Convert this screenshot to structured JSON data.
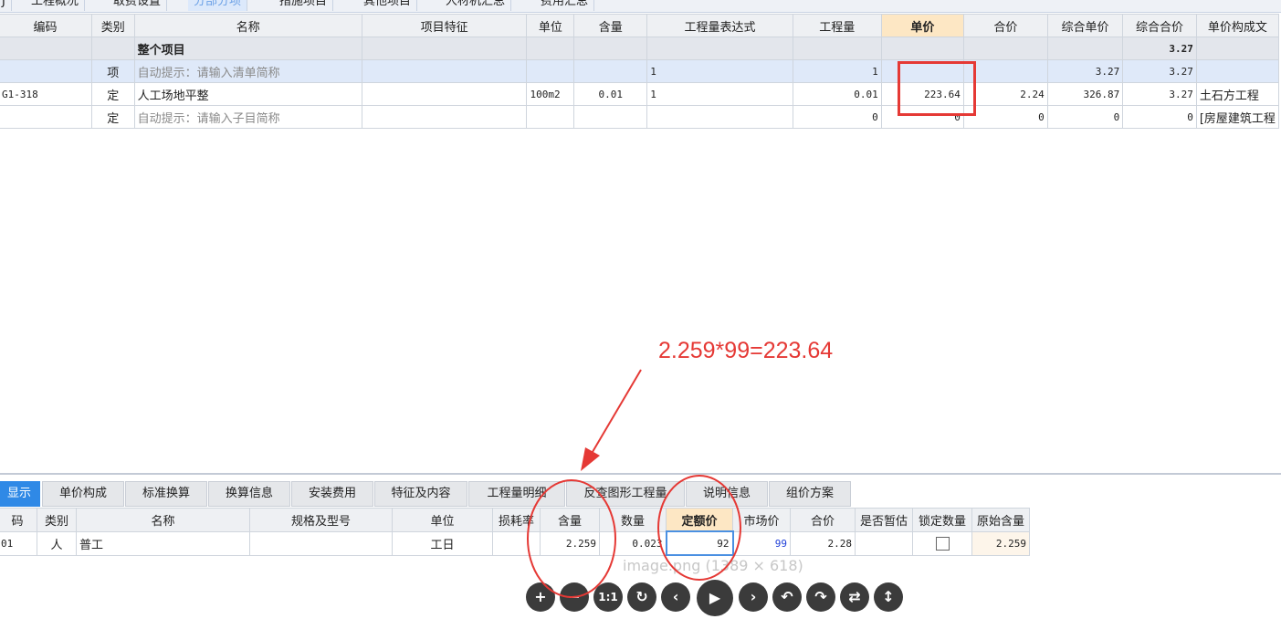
{
  "top_tabs": [
    "J",
    "工程概况",
    "取费设置",
    "分部分项",
    "措施项目",
    "其他项目",
    "人材机汇总",
    "费用汇总"
  ],
  "upper_table": {
    "headers": [
      "编码",
      "类别",
      "名称",
      "项目特征",
      "单位",
      "含量",
      "工程量表达式",
      "工程量",
      "单价",
      "合价",
      "综合单价",
      "综合合价",
      "单价构成文"
    ],
    "rows": [
      {
        "code": "",
        "type": "",
        "name": "整个项目",
        "feature": "",
        "unit": "",
        "content": "",
        "expr": "",
        "qty": "",
        "price": "",
        "total": "",
        "comp_price": "",
        "comp_total": "3.27",
        "composition": ""
      },
      {
        "code": "",
        "type": "项",
        "name": "自动提示：请输入清单简称",
        "feature": "",
        "unit": "",
        "content": "",
        "expr": "1",
        "qty": "1",
        "price": "",
        "total": "",
        "comp_price": "3.27",
        "comp_total": "3.27",
        "composition": ""
      },
      {
        "code": "G1-318",
        "type": "定",
        "name": "人工场地平整",
        "feature": "",
        "unit": "100m2",
        "content": "0.01",
        "expr": "1",
        "qty": "0.01",
        "price": "223.64",
        "total": "2.24",
        "comp_price": "326.87",
        "comp_total": "3.27",
        "composition": "土石方工程"
      },
      {
        "code": "",
        "type": "定",
        "name": "自动提示：请输入子目简称",
        "feature": "",
        "unit": "",
        "content": "",
        "expr": "",
        "qty": "0",
        "price": "0",
        "total": "0",
        "comp_price": "0",
        "comp_total": "0",
        "composition": "[房屋建筑工程"
      }
    ]
  },
  "annotation": "2.259*99=223.64",
  "sub_tabs": [
    "显示",
    "单价构成",
    "标准换算",
    "换算信息",
    "安装费用",
    "特征及内容",
    "工程量明细",
    "反查图形工程量",
    "说明信息",
    "组价方案"
  ],
  "lower_table": {
    "headers": [
      "码",
      "类别",
      "名称",
      "规格及型号",
      "单位",
      "损耗率",
      "含量",
      "数量",
      "定额价",
      "市场价",
      "合价",
      "是否暂估",
      "锁定数量",
      "原始含量"
    ],
    "rows": [
      {
        "code": "01",
        "type": "人",
        "name": "普工",
        "spec": "",
        "unit": "工日",
        "loss": "",
        "content": "2.259",
        "quantity": "0.023",
        "quota_price": "92",
        "market_price": "99",
        "total": "2.28",
        "estimated": "",
        "locked": false,
        "orig_content": "2.259"
      }
    ]
  },
  "watermark": "image.png (1389 × 618)",
  "viewer_buttons": [
    {
      "icon": "zoom-in-icon",
      "glyph": "+"
    },
    {
      "icon": "zoom-out-icon",
      "glyph": "−"
    },
    {
      "icon": "actual-size-icon",
      "glyph": "1:1"
    },
    {
      "icon": "reset-icon",
      "glyph": "↻"
    },
    {
      "icon": "previous-icon",
      "glyph": "‹"
    },
    {
      "icon": "play-icon",
      "glyph": "▶"
    },
    {
      "icon": "next-icon",
      "glyph": "›"
    },
    {
      "icon": "rotate-left-icon",
      "glyph": "↶"
    },
    {
      "icon": "rotate-right-icon",
      "glyph": "↷"
    },
    {
      "icon": "flip-horizontal-icon",
      "glyph": "⇄"
    },
    {
      "icon": "flip-vertical-icon",
      "glyph": "↕"
    }
  ],
  "colors": {
    "annotation": "#e53935",
    "active_tab": "#2f89e6",
    "highlight_header": "#fde7c4"
  }
}
